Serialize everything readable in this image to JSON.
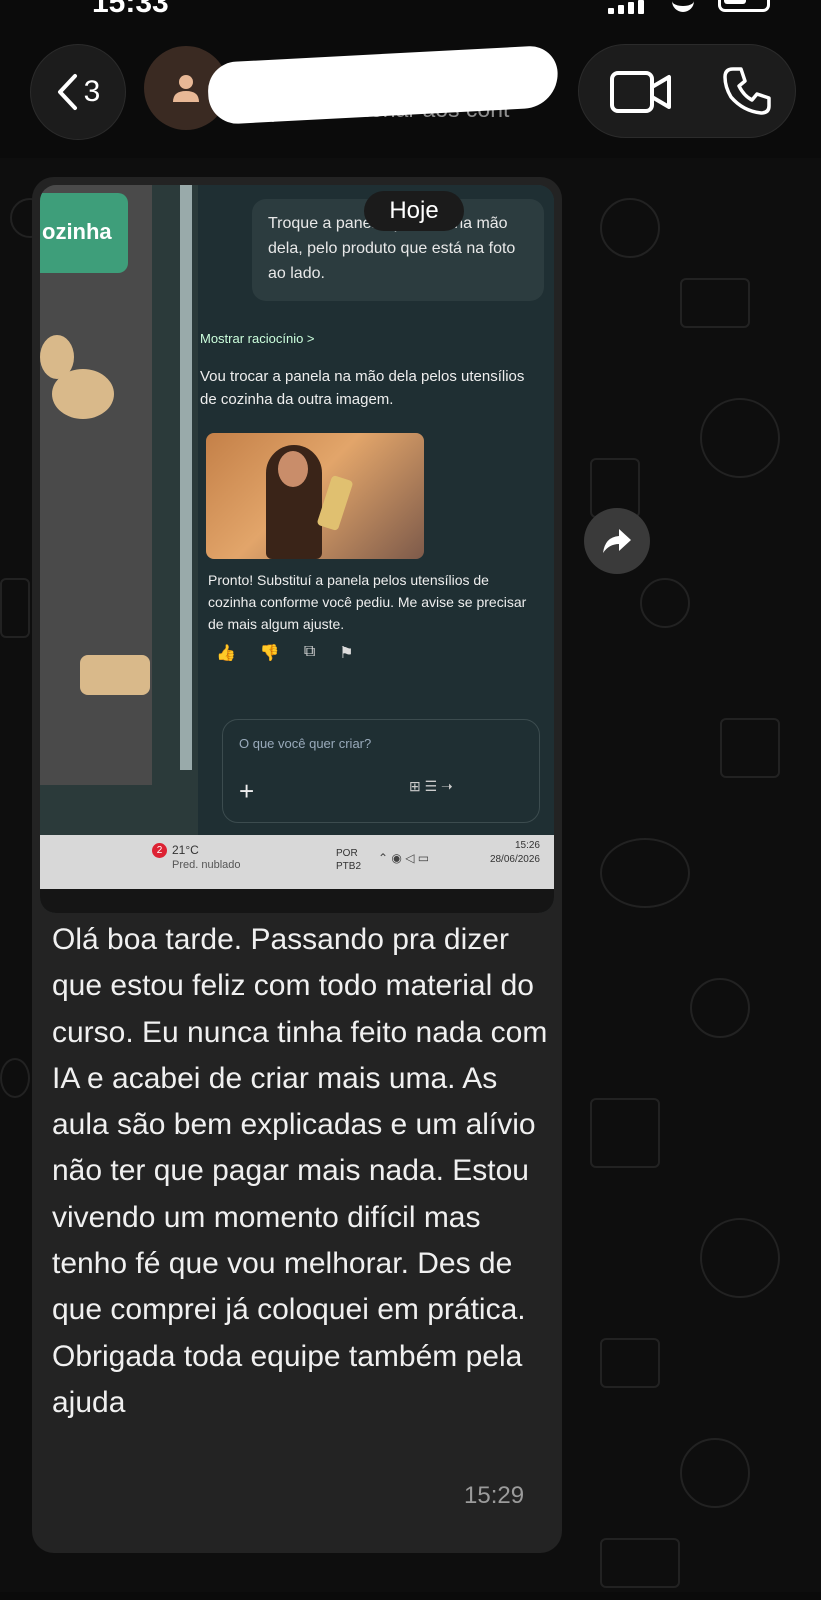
{
  "status_bar": {
    "time": "15:33"
  },
  "header": {
    "back_count": "3",
    "contact_subtitle": "le para adicionar aos cont",
    "icons": [
      "chevron-left-icon",
      "person-icon",
      "video-call-icon",
      "phone-icon"
    ]
  },
  "date_chip": "Hoje",
  "message": {
    "photo": {
      "side_label": "ozinha",
      "prompt": "Troque a panela que está na mão dela, pelo produto que está na foto ao lado.",
      "show_reasoning": "Mostrar raciocínio >",
      "ai_reply": "Vou trocar a panela na mão dela pelos utensílios de cozinha da outra imagem.",
      "done_reply": "Pronto! Substituí a panela pelos utensílios de cozinha conforme você pediu. Me avise se precisar de mais algum ajuste.",
      "input_placeholder": "O que você quer criar?",
      "input_plus": "+",
      "taskbar": {
        "notification_count": "2",
        "temperature": "21°C",
        "weather": "Pred. nublado",
        "language": "POR",
        "layout": "PTB2",
        "clock_time": "15:26",
        "clock_date": "28/06/2026"
      }
    },
    "text": "Olá boa tarde. Passando pra dizer que estou feliz com todo material do curso. Eu nunca tinha feito nada com IA e acabei de criar mais uma. As aula são bem explicadas e um alívio não ter que pagar mais nada. Estou vivendo um momento difícil mas tenho fé que vou melhorar. Des de que comprei já coloquei em prática. Obrigada toda equipe também pela ajuda",
    "time": "15:29"
  },
  "colors": {
    "background": "#0b0b0b",
    "bubble": "#232323",
    "timestamp": "#9b9b9b"
  }
}
